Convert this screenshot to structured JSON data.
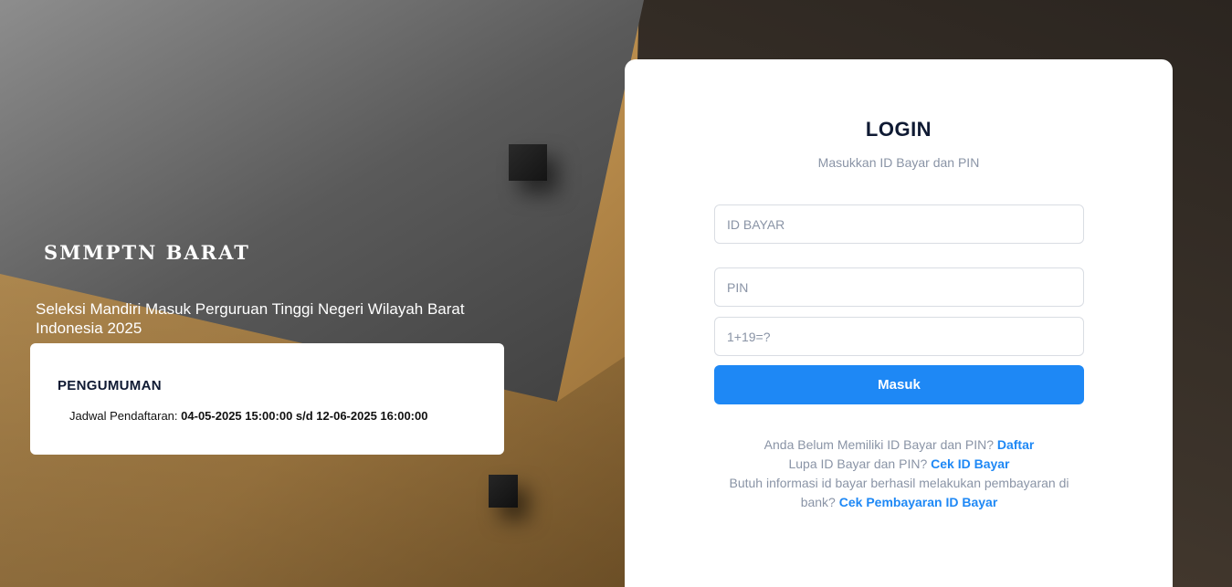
{
  "brand": "SMMPTN BARAT",
  "tagline": "Seleksi Mandiri Masuk Perguruan Tinggi Negeri Wilayah Barat Indonesia 2025",
  "announcement": {
    "title": "PENGUMUMAN",
    "label": "Jadwal Pendaftaran:",
    "value": "04-05-2025 15:00:00 s/d 12-06-2025 16:00:00"
  },
  "login": {
    "title": "LOGIN",
    "subtitle": "Masukkan ID Bayar dan PIN",
    "id_placeholder": "ID BAYAR",
    "id_value": "",
    "pin_placeholder": "PIN",
    "pin_value": "",
    "captcha_placeholder": "1+19=?",
    "captcha_value": "",
    "submit_label": "Masuk"
  },
  "links": {
    "register_text": "Anda Belum Memiliki ID Bayar dan PIN?",
    "register_link": "Daftar",
    "forgot_text": "Lupa ID Bayar dan PIN?",
    "forgot_link": "Cek ID Bayar",
    "payment_text": "Butuh informasi id bayar berhasil melakukan pembayaran di bank?",
    "payment_link": "Cek Pembayaran ID Bayar"
  },
  "colors": {
    "accent": "#1e88f5",
    "title": "#0f1a33",
    "muted": "#8a94a6"
  }
}
